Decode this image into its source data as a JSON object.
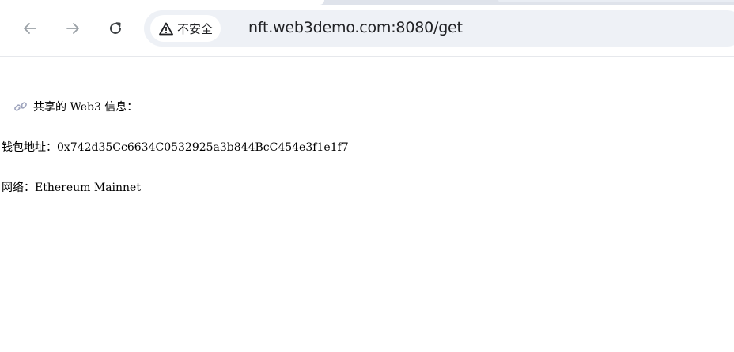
{
  "browser": {
    "security_label": "不安全",
    "url": "nft.web3demo.com:8080/get",
    "nav_icons": [
      "back-arrow-icon",
      "forward-arrow-icon",
      "reload-icon",
      "warning-triangle-icon"
    ]
  },
  "page": {
    "heading_text": "共享的 Web3 信息：",
    "heading_icon": "link-icon",
    "wallet_line": "钱包地址：0x742d35Cc6634C0532925a3b844BcC454e3f1e1f7",
    "network_line": "网络：Ethereum Mainnet"
  },
  "colors": {
    "icon_gray": "#5f6368",
    "omnibox_bg": "#eef1f6",
    "text": "#202124",
    "link_icon": "#9aa0ba"
  }
}
